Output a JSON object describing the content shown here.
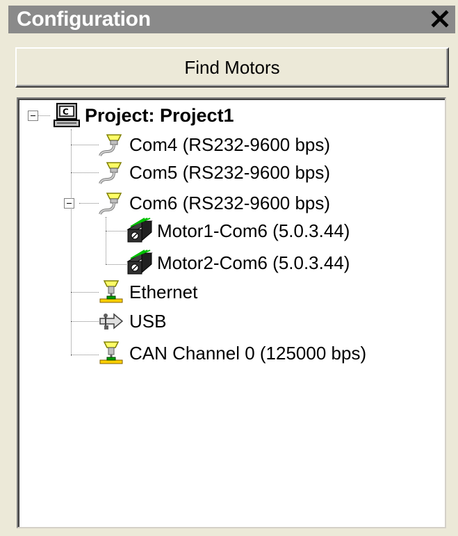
{
  "window": {
    "title": "Configuration",
    "close_icon": "close-icon"
  },
  "toolbar": {
    "find_motors_label": "Find Motors"
  },
  "tree": {
    "root": {
      "label": "Project: Project1",
      "icon": "computer-icon",
      "expanded": true
    },
    "ports": [
      {
        "label": "Com4 (RS232-9600 bps)",
        "icon": "serial-port-icon"
      },
      {
        "label": "Com5 (RS232-9600 bps)",
        "icon": "serial-port-icon"
      },
      {
        "label": "Com6 (RS232-9600 bps)",
        "icon": "serial-port-icon",
        "expanded": true
      },
      {
        "label": "Ethernet",
        "icon": "ethernet-icon"
      },
      {
        "label": "USB",
        "icon": "usb-icon"
      },
      {
        "label": "CAN Channel 0 (125000 bps)",
        "icon": "can-bus-icon"
      }
    ],
    "motors": [
      {
        "label": "Motor1-Com6 (5.0.3.44)",
        "icon": "motor-icon"
      },
      {
        "label": "Motor2-Com6 (5.0.3.44)",
        "icon": "motor-icon"
      }
    ]
  },
  "colors": {
    "titlebar": "#8a8a8a",
    "panel": "#ece9d8",
    "motor_led": "#00c000"
  }
}
